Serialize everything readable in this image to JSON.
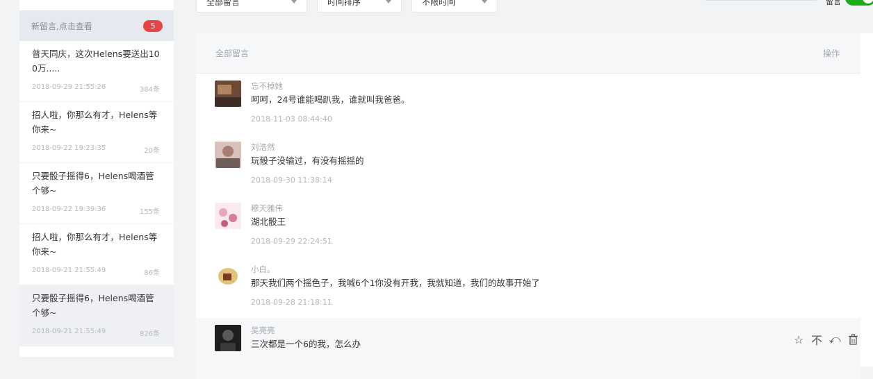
{
  "filters": {
    "type": "全部留言",
    "sort": "时间排序",
    "time": "不限时间",
    "toggle_label": "留言"
  },
  "sidebar": {
    "header": "新留言,点击查看",
    "badge": "5",
    "items": [
      {
        "title": "普天同庆，这次Helens要送出100万.....",
        "time": "2018-09-29 21:55:26",
        "count": "384条"
      },
      {
        "title": "招人啦，你那么有才，Helens等你来~",
        "time": "2018-09-22 19:23:35",
        "count": "20条"
      },
      {
        "title": "只要骰子摇得6，Helens喝酒管个够~",
        "time": "2018-09-22 19:39:36",
        "count": "155条"
      },
      {
        "title": "招人啦，你那么有才，Helens等你来~",
        "time": "2018-09-21 21:55:49",
        "count": "86条"
      },
      {
        "title": "只要骰子摇得6，Helens喝酒管个够~",
        "time": "2018-09-21 21:55:49",
        "count": "826条"
      }
    ]
  },
  "main": {
    "header_left": "全部留言",
    "header_right": "操作",
    "comments": [
      {
        "name": "忘不掉她",
        "text": "呵呵，24号谁能喝趴我，谁就叫我爸爸。",
        "time": "2018-11-03 08:44:40",
        "avatar_color": "#6b4a3a"
      },
      {
        "name": "刘浩然",
        "text": "玩骰子没输过，有没有摇摇的",
        "time": "2018-09-30 11:38:14",
        "avatar_color": "#c7a9a0"
      },
      {
        "name": "穆天雅伟",
        "text": "湖北骰王",
        "time": "2018-09-29 22:24:51",
        "avatar_color": "#e8b7c9"
      },
      {
        "name": "小白。",
        "text": "那天我们两个摇色子，我喊6个1你没有开我，我就知道，我们的故事开始了",
        "time": "2018-09-28 21:18:11",
        "avatar_color": "#d9b56a"
      },
      {
        "name": "吴亮亮",
        "text": "三次都是一个6的我，怎么办",
        "time": "",
        "avatar_color": "#2c2c2c"
      }
    ]
  },
  "actions": {
    "star": "☆",
    "top": "不",
    "reply": "⤺",
    "delete": "🗑"
  }
}
